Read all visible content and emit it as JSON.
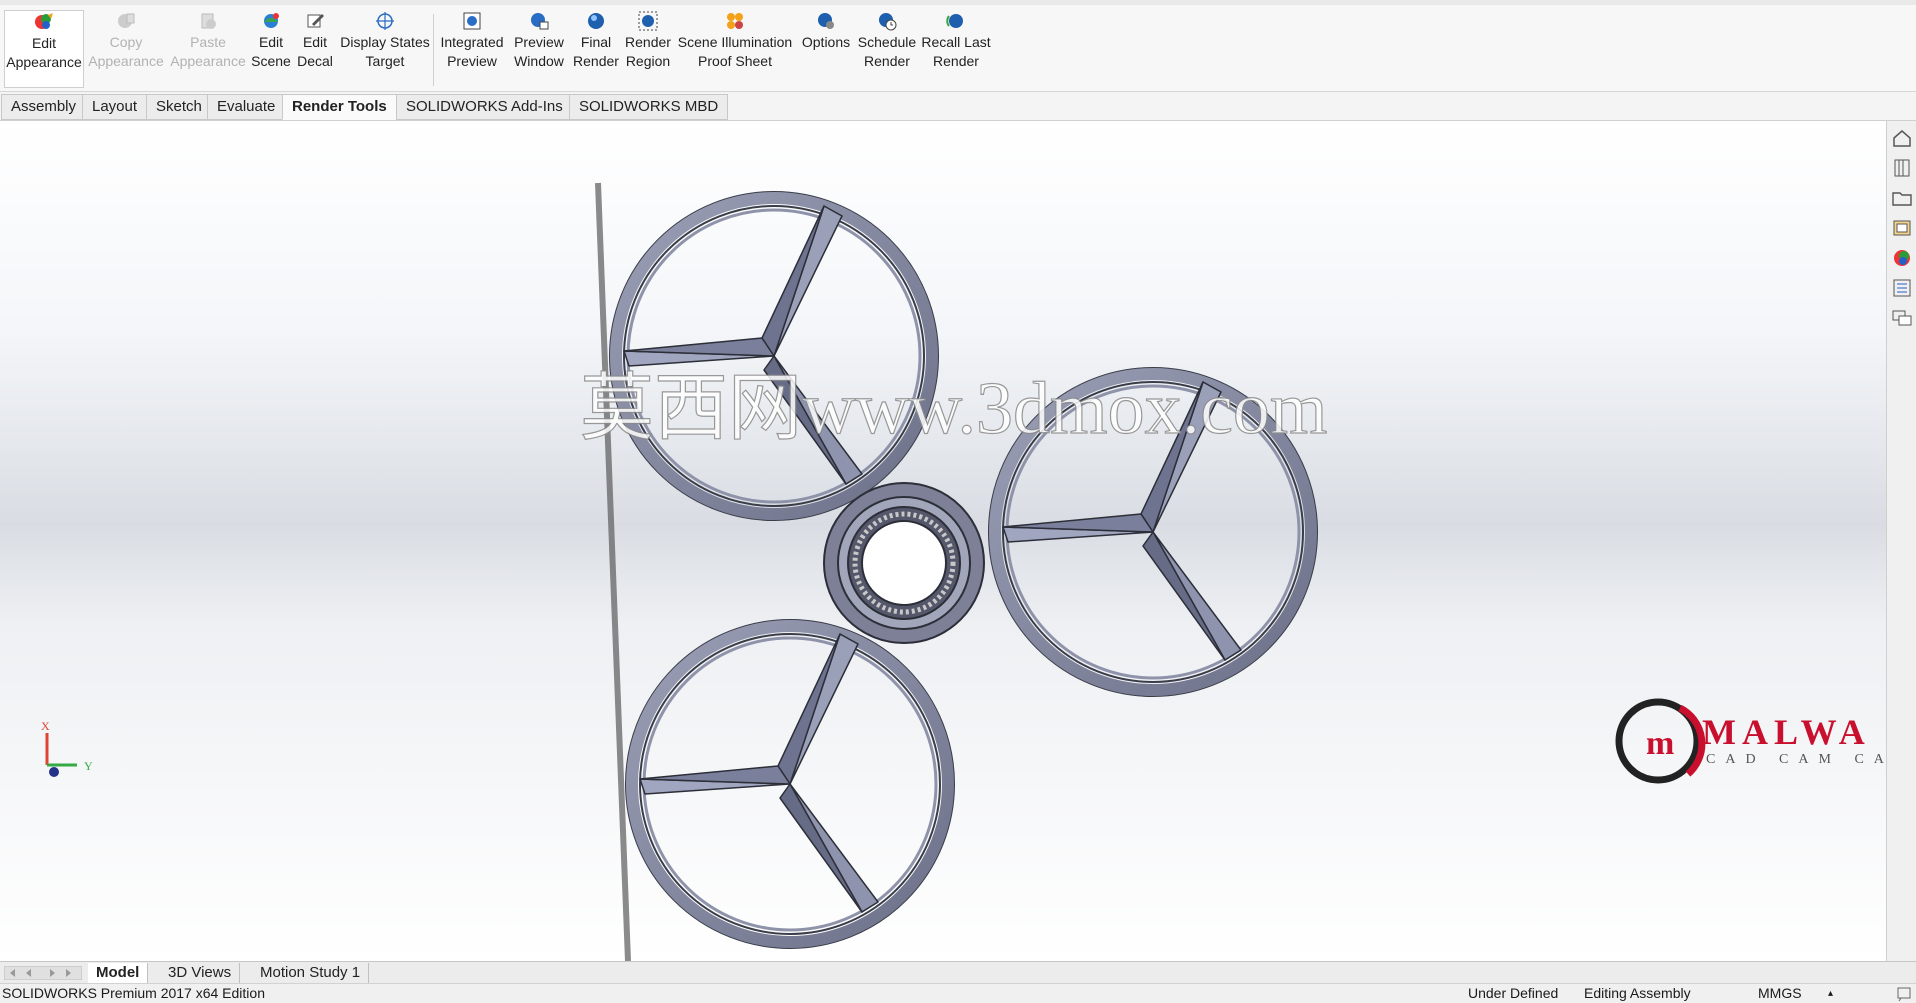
{
  "ribbon": {
    "edit_appearance": [
      "Edit",
      "Appearance"
    ],
    "copy_appearance": [
      "Copy",
      "Appearance"
    ],
    "paste_appearance": [
      "Paste",
      "Appearance"
    ],
    "edit_scene": [
      "Edit",
      "Scene"
    ],
    "edit_decal": [
      "Edit",
      "Decal"
    ],
    "display_states_target": [
      "Display States",
      "Target"
    ],
    "integrated_preview": [
      "Integrated",
      "Preview"
    ],
    "preview_window": [
      "Preview",
      "Window"
    ],
    "final_render": [
      "Final",
      "Render"
    ],
    "render_region": [
      "Render",
      "Region"
    ],
    "scene_illumination": [
      "Scene Illumination",
      "Proof Sheet"
    ],
    "options": [
      "Options",
      ""
    ],
    "schedule_render": [
      "Schedule",
      "Render"
    ],
    "recall_last_render": [
      "Recall Last",
      "Render"
    ]
  },
  "tabs": [
    "Assembly",
    "Layout",
    "Sketch",
    "Evaluate",
    "Render Tools",
    "SOLIDWORKS Add-Ins",
    "SOLIDWORKS MBD"
  ],
  "active_tab": "Render Tools",
  "viewport": {
    "watermark": "莫西网www.3dmox.com",
    "logo_text": "MALWA",
    "logo_sub": "CAD CAM CAE",
    "triad_x": "X",
    "triad_y": "Y"
  },
  "bottom_tabs": [
    "Model",
    "3D Views",
    "Motion Study 1"
  ],
  "status": {
    "edition": "SOLIDWORKS Premium 2017 x64 Edition",
    "state": "Under Defined",
    "mode": "Editing Assembly",
    "units": "MMGS"
  },
  "colors": {
    "accent_red": "#c8102e",
    "part_gray": "#8a8ea6"
  }
}
